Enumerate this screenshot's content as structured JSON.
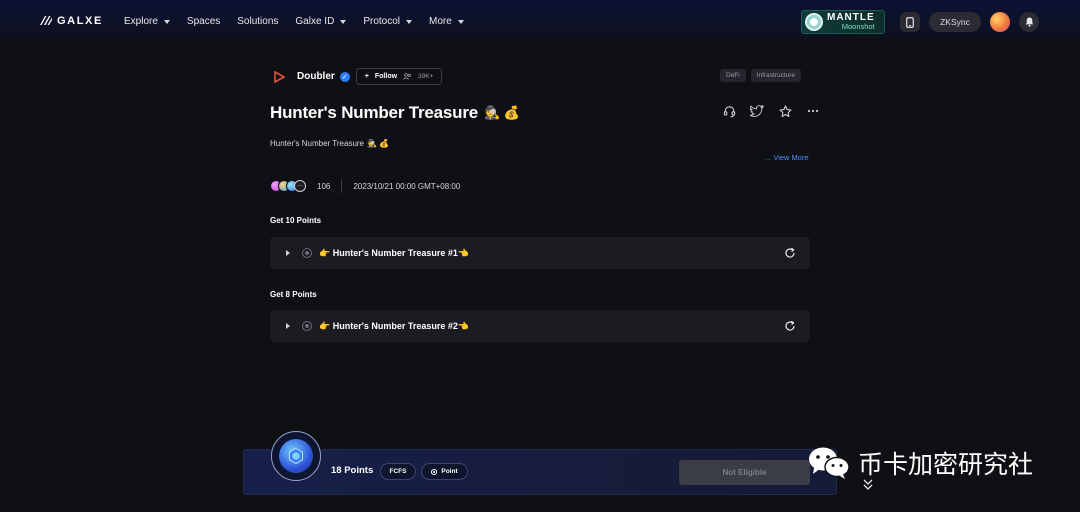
{
  "header": {
    "logo_text": "GALXE",
    "nav": [
      {
        "label": "Explore",
        "dropdown": true
      },
      {
        "label": "Spaces",
        "dropdown": false
      },
      {
        "label": "Solutions",
        "dropdown": false
      },
      {
        "label": "Galxe ID",
        "dropdown": true
      },
      {
        "label": "Protocol",
        "dropdown": true
      },
      {
        "label": "More",
        "dropdown": true
      }
    ],
    "promo_title": "MANTLE",
    "promo_subtitle": "Moonshot",
    "network_label": "ZKSync"
  },
  "space": {
    "name": "Doubler",
    "follow_label": "Follow",
    "follow_count": "39K+",
    "tags": [
      "DeFi",
      "Infrastructure"
    ]
  },
  "campaign": {
    "title": "Hunter's Number Treasure",
    "title_emojis": "🕵️ 💰",
    "description": "Hunter's Number Treasure",
    "description_emojis": "🕵️ 💰",
    "view_more": "... View More",
    "participants_count": "106",
    "more_avatars": "···",
    "date": "2023/10/21 00:00 GMT+08:00"
  },
  "sections": [
    {
      "label": "Get 10 Points",
      "task": "👉 Hunter's Number Treasure #1👈"
    },
    {
      "label": "Get 8 Points",
      "task": "👉 Hunter's Number Treasure #2👈"
    }
  ],
  "footer": {
    "points": "18 Points",
    "pill_fcfs": "FCFS",
    "pill_point": "Point",
    "cta": "Not Eligible"
  },
  "watermark": {
    "text": "币卡加密研究社"
  },
  "colors": {
    "accent_blue": "#2f7bff",
    "link_blue": "#4c8cff",
    "bg": "#0f1014",
    "card": "#1b1c22"
  }
}
